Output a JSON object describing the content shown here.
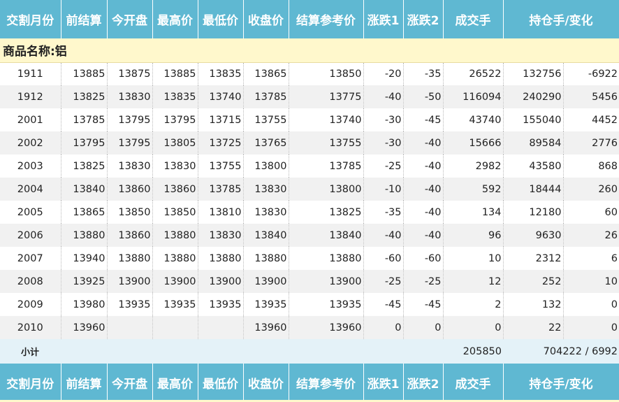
{
  "headers": [
    "交割月份",
    "前结算",
    "今开盘",
    "最高价",
    "最低价",
    "收盘价",
    "结算参考价",
    "涨跌1",
    "涨跌2",
    "成交手",
    "持仓手/变化"
  ],
  "product_label": "商品名称:铝",
  "rows": [
    [
      "1911",
      "13885",
      "13875",
      "13885",
      "13835",
      "13865",
      "13850",
      "-20",
      "-35",
      "26522",
      "132756",
      "-6922"
    ],
    [
      "1912",
      "13825",
      "13830",
      "13835",
      "13740",
      "13785",
      "13775",
      "-40",
      "-50",
      "116094",
      "240290",
      "5456"
    ],
    [
      "2001",
      "13785",
      "13795",
      "13795",
      "13715",
      "13755",
      "13740",
      "-30",
      "-45",
      "43740",
      "155040",
      "4452"
    ],
    [
      "2002",
      "13795",
      "13795",
      "13805",
      "13725",
      "13765",
      "13755",
      "-30",
      "-40",
      "15666",
      "89584",
      "2776"
    ],
    [
      "2003",
      "13825",
      "13830",
      "13830",
      "13755",
      "13800",
      "13785",
      "-25",
      "-40",
      "2982",
      "43580",
      "868"
    ],
    [
      "2004",
      "13840",
      "13860",
      "13860",
      "13785",
      "13830",
      "13800",
      "-10",
      "-40",
      "592",
      "18444",
      "260"
    ],
    [
      "2005",
      "13865",
      "13850",
      "13850",
      "13810",
      "13830",
      "13825",
      "-35",
      "-40",
      "134",
      "12180",
      "60"
    ],
    [
      "2006",
      "13880",
      "13860",
      "13880",
      "13830",
      "13840",
      "13840",
      "-40",
      "-40",
      "96",
      "9630",
      "26"
    ],
    [
      "2007",
      "13940",
      "13880",
      "13880",
      "13880",
      "13880",
      "13880",
      "-60",
      "-60",
      "10",
      "2312",
      "6"
    ],
    [
      "2008",
      "13925",
      "13900",
      "13900",
      "13900",
      "13900",
      "13900",
      "-25",
      "-25",
      "12",
      "252",
      "10"
    ],
    [
      "2009",
      "13980",
      "13935",
      "13935",
      "13935",
      "13935",
      "13935",
      "-45",
      "-45",
      "2",
      "132",
      "0"
    ],
    [
      "2010",
      "13960",
      "",
      "",
      "",
      "13960",
      "13960",
      "0",
      "0",
      "0",
      "22",
      "0"
    ]
  ],
  "subtotal": {
    "label": "小计",
    "volume": "205850",
    "open_interest": "704222 / 6992"
  }
}
